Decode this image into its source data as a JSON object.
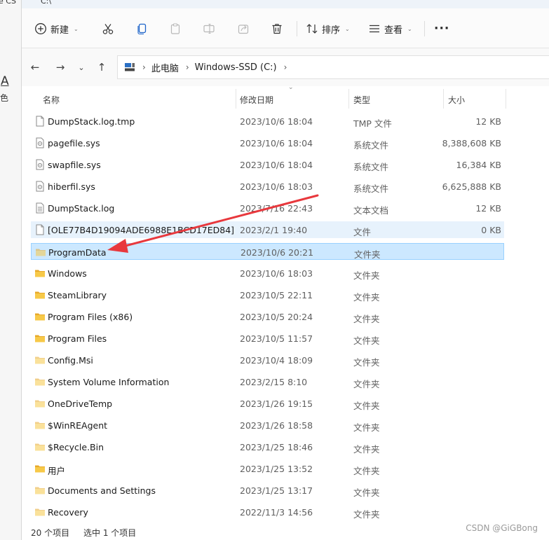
{
  "background_window": {
    "title_fragment": "e CS",
    "letter": "A",
    "char": "色"
  },
  "window": {
    "title": "C:\\"
  },
  "toolbar": {
    "new_label": "新建",
    "sort_label": "排序",
    "view_label": "查看",
    "more_label": "···"
  },
  "address": {
    "computer": "此电脑",
    "drive": "Windows-SSD (C:)"
  },
  "columns": {
    "name": "名称",
    "date": "修改日期",
    "type": "类型",
    "size": "大小"
  },
  "files": [
    {
      "name": "DumpStack.log.tmp",
      "date": "2023/10/6 18:04",
      "type": "TMP 文件",
      "size": "12 KB",
      "kind": "file"
    },
    {
      "name": "pagefile.sys",
      "date": "2023/10/6 18:04",
      "type": "系统文件",
      "size": "8,388,608 KB",
      "kind": "sys"
    },
    {
      "name": "swapfile.sys",
      "date": "2023/10/6 18:04",
      "type": "系统文件",
      "size": "16,384 KB",
      "kind": "sys"
    },
    {
      "name": "hiberfil.sys",
      "date": "2023/10/6 18:03",
      "type": "系统文件",
      "size": "6,625,888 KB",
      "kind": "sys"
    },
    {
      "name": "DumpStack.log",
      "date": "2023/7/16 22:43",
      "type": "文本文档",
      "size": "12 KB",
      "kind": "text"
    },
    {
      "name": "[OLE77B4D19094ADE6988E1BCD17ED84]",
      "date": "2023/2/1 19:40",
      "type": "文件",
      "size": "0 KB",
      "kind": "file",
      "state": "hover"
    },
    {
      "name": "ProgramData",
      "date": "2023/10/6 20:21",
      "type": "文件夹",
      "size": "",
      "kind": "folder-hidden",
      "state": "selected"
    },
    {
      "name": "Windows",
      "date": "2023/10/6 18:03",
      "type": "文件夹",
      "size": "",
      "kind": "folder"
    },
    {
      "name": "SteamLibrary",
      "date": "2023/10/5 22:11",
      "type": "文件夹",
      "size": "",
      "kind": "folder"
    },
    {
      "name": "Program Files (x86)",
      "date": "2023/10/5 20:24",
      "type": "文件夹",
      "size": "",
      "kind": "folder"
    },
    {
      "name": "Program Files",
      "date": "2023/10/5 11:57",
      "type": "文件夹",
      "size": "",
      "kind": "folder"
    },
    {
      "name": "Config.Msi",
      "date": "2023/10/4 18:09",
      "type": "文件夹",
      "size": "",
      "kind": "folder-hidden"
    },
    {
      "name": "System Volume Information",
      "date": "2023/2/15 8:10",
      "type": "文件夹",
      "size": "",
      "kind": "folder-hidden"
    },
    {
      "name": "OneDriveTemp",
      "date": "2023/1/26 19:15",
      "type": "文件夹",
      "size": "",
      "kind": "folder-hidden"
    },
    {
      "name": "$WinREAgent",
      "date": "2023/1/26 18:58",
      "type": "文件夹",
      "size": "",
      "kind": "folder-hidden"
    },
    {
      "name": "$Recycle.Bin",
      "date": "2023/1/25 18:46",
      "type": "文件夹",
      "size": "",
      "kind": "folder-hidden"
    },
    {
      "name": "用户",
      "date": "2023/1/25 13:52",
      "type": "文件夹",
      "size": "",
      "kind": "folder"
    },
    {
      "name": "Documents and Settings",
      "date": "2023/1/25 13:17",
      "type": "文件夹",
      "size": "",
      "kind": "folder-hidden"
    },
    {
      "name": "Recovery",
      "date": "2022/11/3 14:56",
      "type": "文件夹",
      "size": "",
      "kind": "folder-hidden"
    }
  ],
  "status": {
    "count": "20 个项目",
    "selected": "选中 1 个项目"
  },
  "watermark": "CSDN @GiGBong",
  "colors": {
    "selection_bg": "#cce8ff",
    "selection_border": "#99d1ff",
    "hover_bg": "#e7f2fc",
    "folder": "#f7c948",
    "annotation_arrow": "#e8383d"
  }
}
